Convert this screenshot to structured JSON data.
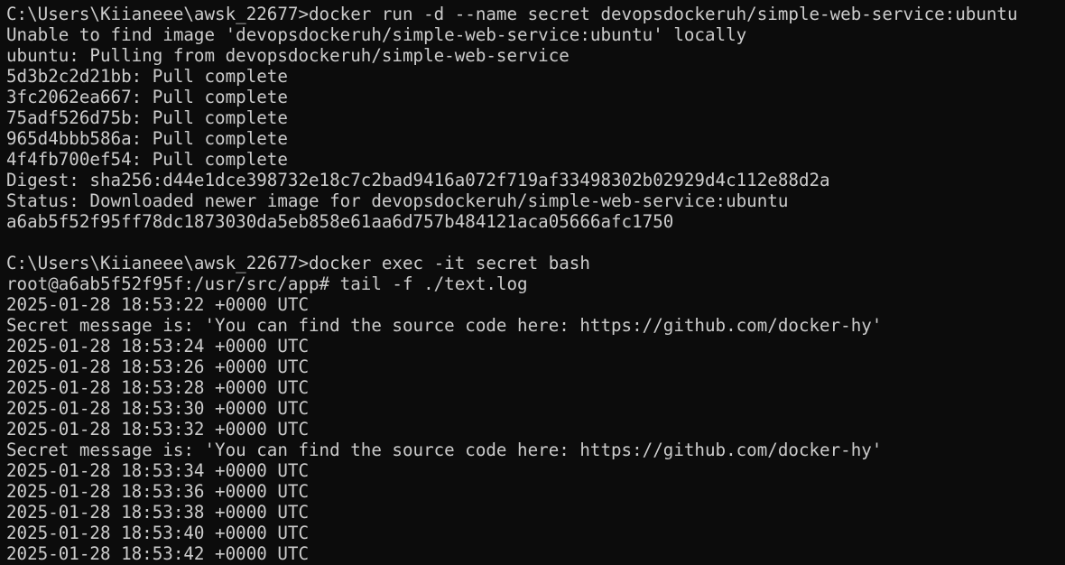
{
  "terminal": {
    "lines": [
      "C:\\Users\\Kiianeee\\awsk_22677>docker run -d --name secret devopsdockeruh/simple-web-service:ubuntu",
      "Unable to find image 'devopsdockeruh/simple-web-service:ubuntu' locally",
      "ubuntu: Pulling from devopsdockeruh/simple-web-service",
      "5d3b2c2d21bb: Pull complete",
      "3fc2062ea667: Pull complete",
      "75adf526d75b: Pull complete",
      "965d4bbb586a: Pull complete",
      "4f4fb700ef54: Pull complete",
      "Digest: sha256:d44e1dce398732e18c7c2bad9416a072f719af33498302b02929d4c112e88d2a",
      "Status: Downloaded newer image for devopsdockeruh/simple-web-service:ubuntu",
      "a6ab5f52f95ff78dc1873030da5eb858e61aa6d757b484121aca05666afc1750",
      "",
      "C:\\Users\\Kiianeee\\awsk_22677>docker exec -it secret bash",
      "root@a6ab5f52f95f:/usr/src/app# tail -f ./text.log",
      "2025-01-28 18:53:22 +0000 UTC",
      "Secret message is: 'You can find the source code here: https://github.com/docker-hy'",
      "2025-01-28 18:53:24 +0000 UTC",
      "2025-01-28 18:53:26 +0000 UTC",
      "2025-01-28 18:53:28 +0000 UTC",
      "2025-01-28 18:53:30 +0000 UTC",
      "2025-01-28 18:53:32 +0000 UTC",
      "Secret message is: 'You can find the source code here: https://github.com/docker-hy'",
      "2025-01-28 18:53:34 +0000 UTC",
      "2025-01-28 18:53:36 +0000 UTC",
      "2025-01-28 18:53:38 +0000 UTC",
      "2025-01-28 18:53:40 +0000 UTC",
      "2025-01-28 18:53:42 +0000 UTC"
    ]
  },
  "colors": {
    "background": "#0c0c0c",
    "foreground": "#cccccc"
  }
}
